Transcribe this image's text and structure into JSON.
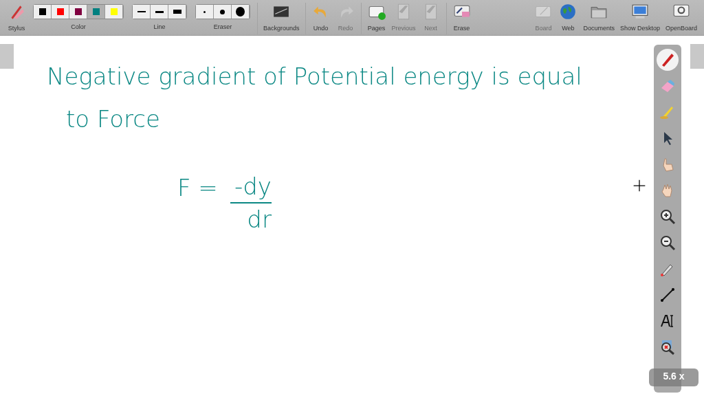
{
  "toolbar": {
    "left": [
      {
        "kind": "button",
        "label": "Stylus",
        "disabled": false
      },
      {
        "kind": "colors",
        "label": "Color",
        "swatches": [
          {
            "color": "#000000",
            "selected": false
          },
          {
            "color": "#ff0000",
            "selected": false
          },
          {
            "color": "#800040",
            "selected": false
          },
          {
            "color": "#008080",
            "selected": true
          },
          {
            "color": "#ffff00",
            "selected": false
          }
        ]
      },
      {
        "kind": "lines",
        "label": "Line"
      },
      {
        "kind": "erasers",
        "label": "Eraser"
      },
      {
        "kind": "button",
        "label": "Backgrounds",
        "disabled": false
      },
      {
        "kind": "button",
        "label": "Undo",
        "disabled": false
      },
      {
        "kind": "button",
        "label": "Redo",
        "disabled": true
      },
      {
        "kind": "button",
        "label": "Pages",
        "disabled": false
      },
      {
        "kind": "button",
        "label": "Previous",
        "disabled": true
      },
      {
        "kind": "button",
        "label": "Next",
        "disabled": true
      },
      {
        "kind": "button",
        "label": "Erase",
        "disabled": false
      }
    ],
    "right": [
      {
        "label": "Board",
        "disabled": true
      },
      {
        "label": "Web",
        "disabled": false
      },
      {
        "label": "Documents",
        "disabled": false
      },
      {
        "label": "Show Desktop",
        "disabled": false
      },
      {
        "label": "OpenBoard",
        "disabled": false
      }
    ]
  },
  "board": {
    "lines": [
      "Negative gradient of Potential energy is equal",
      "to Force"
    ],
    "formula": {
      "lhs": "F =",
      "numerator": "-dy",
      "denominator": "dr"
    }
  },
  "dock": {
    "tools": [
      {
        "selected": true
      },
      {
        "selected": false
      },
      {
        "selected": false
      },
      {
        "selected": false
      },
      {
        "selected": false
      },
      {
        "selected": false
      },
      {
        "selected": false
      },
      {
        "selected": false
      },
      {
        "selected": false
      },
      {
        "selected": false
      },
      {
        "selected": false
      },
      {
        "selected": false
      }
    ],
    "zoom": "5.6 x"
  }
}
